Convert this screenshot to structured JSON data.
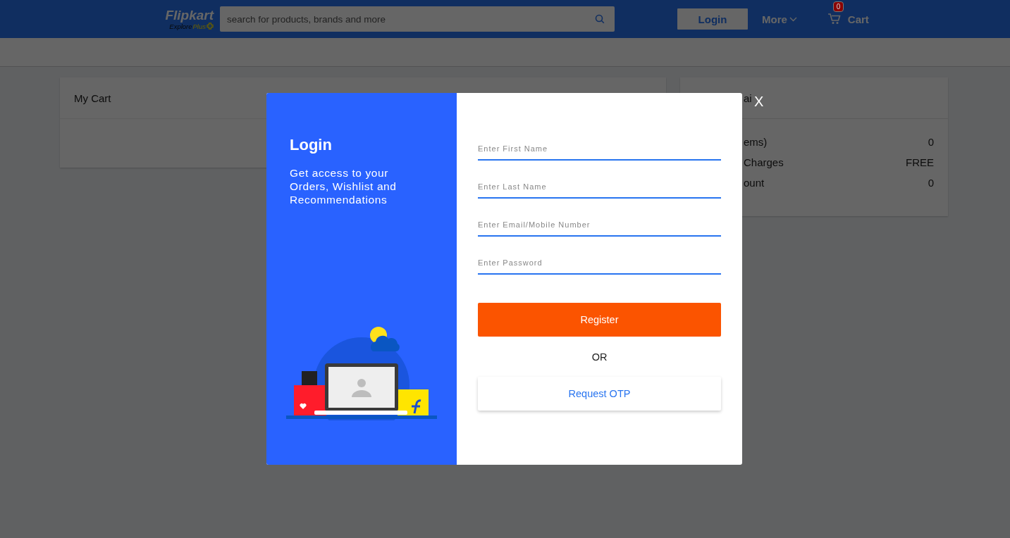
{
  "header": {
    "logo": "Flipkart",
    "tagline_explore": "Explore",
    "tagline_plus": "Plus",
    "search": {
      "placeholder": "search for products, brands and more"
    },
    "login_button": "Login",
    "more_menu": "More",
    "cart": {
      "label": "Cart",
      "count": "0"
    }
  },
  "cart_card": {
    "title": "My Cart"
  },
  "price_card": {
    "title": "ai",
    "rows": [
      {
        "label": "ems)",
        "value": "0"
      },
      {
        "label": "Charges",
        "value": "FREE"
      },
      {
        "label": "ount",
        "value": "0"
      }
    ]
  },
  "modal": {
    "close": "X",
    "title": "Login",
    "subtitle": "Get access to your Orders, Wishlist and Recommendations",
    "fields": [
      {
        "placeholder": "Enter First Name"
      },
      {
        "placeholder": "Enter Last Name"
      },
      {
        "placeholder": "Enter Email/Mobile Number"
      },
      {
        "placeholder": "Enter Password"
      }
    ],
    "register_button": "Register",
    "separator": "OR",
    "otp_button": "Request OTP"
  }
}
